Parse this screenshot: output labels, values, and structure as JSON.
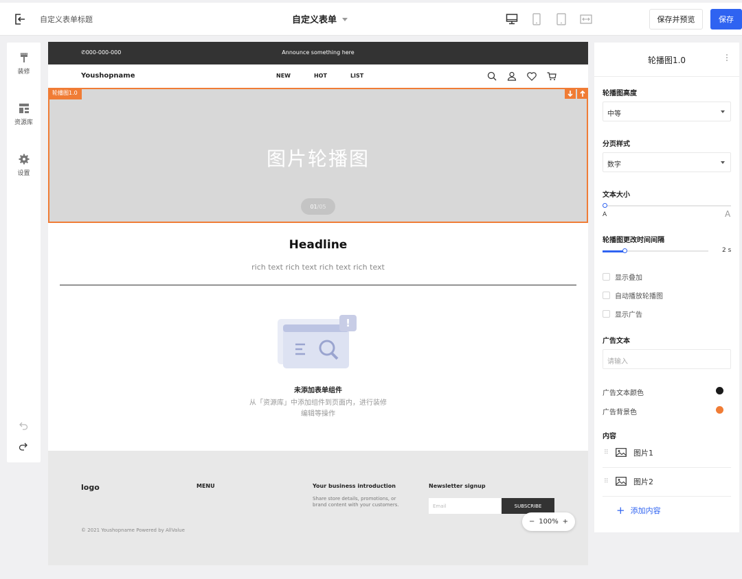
{
  "topbar": {
    "doc_title": "自定义表单标题",
    "form_name": "自定义表单",
    "preview_label": "保存并预览",
    "save_label": "保存"
  },
  "leftrail": {
    "items": [
      {
        "label": "装修",
        "icon": "paintbrush-icon"
      },
      {
        "label": "资源库",
        "icon": "layout-grid-icon"
      },
      {
        "label": "设置",
        "icon": "gear-icon"
      }
    ]
  },
  "shop": {
    "phone": "000-000-000",
    "announcement": "Announce something here",
    "name": "Youshopname",
    "nav": [
      "NEW",
      "HOT",
      "LIST"
    ]
  },
  "carousel": {
    "tag": "轮播图1.0",
    "title": "图片轮播图",
    "page_current": "01",
    "page_total": "/05"
  },
  "content": {
    "headline": "Headline",
    "richtext": "rich text rich text rich text rich text",
    "empty_title": "未添加表单组件",
    "empty_desc": "从「资源库」中添加组件到页面内，进行装修编辑等操作"
  },
  "footer": {
    "logo": "logo",
    "menu": "MENU",
    "biz_title": "Your business introduction",
    "biz_desc": "Share store details, promotions, or brand content with your customers.",
    "newsletter_title": "Newsletter signup",
    "email_placeholder": "Email",
    "subscribe_label": "SUBSCRIBE",
    "copyright": "© 2021 Youshopname Powered by AllValue"
  },
  "zoom": {
    "minus": "−",
    "level": "100%",
    "plus": "+"
  },
  "panel": {
    "title": "轮播图1.0",
    "height_label": "轮播图高度",
    "height_value": "中等",
    "pager_style_label": "分页样式",
    "pager_style_value": "数字",
    "text_size_label": "文本大小",
    "text_size_small": "A",
    "text_size_large": "A",
    "text_size_level": 0,
    "interval_label": "轮播图更改时间间隔",
    "interval_value": "2 s",
    "interval_level": 0.21,
    "checkboxes": [
      "显示叠加",
      "自动播放轮播图",
      "显示广告"
    ],
    "ad_text_label": "广告文本",
    "ad_text_placeholder": "请输入",
    "ad_text_color_label": "广告文本颜色",
    "ad_text_color": "#1a1a1a",
    "ad_bg_color_label": "广告背景色",
    "ad_bg_color": "#f07c35",
    "content_label": "内容",
    "images": [
      "图片1",
      "图片2"
    ],
    "add_content": "添加内容"
  },
  "colors": {
    "accent": "#2f63f1",
    "highlight": "#f07c35"
  }
}
